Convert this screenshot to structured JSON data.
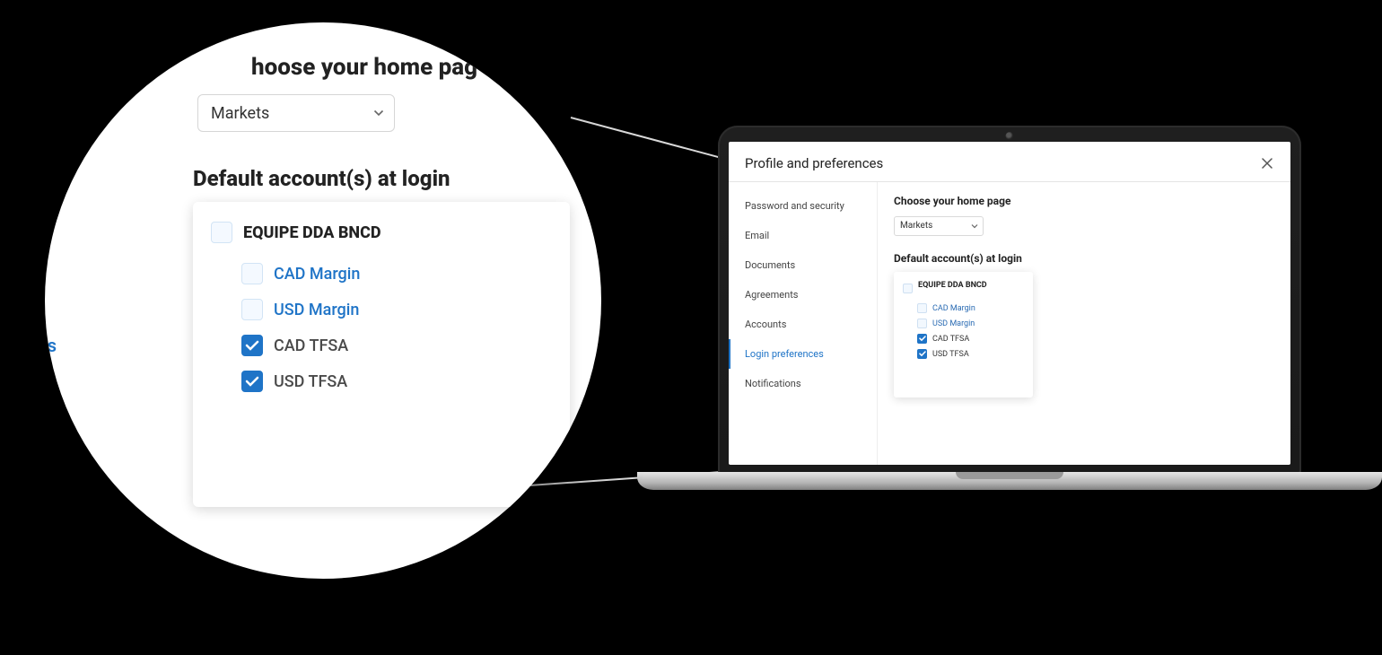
{
  "dialog": {
    "title": "Profile and preferences"
  },
  "sidebar": {
    "items": [
      {
        "label": "Password and security",
        "active": false
      },
      {
        "label": "Email",
        "active": false
      },
      {
        "label": "Documents",
        "active": false
      },
      {
        "label": "Agreements",
        "active": false
      },
      {
        "label": "Accounts",
        "active": false
      },
      {
        "label": "Login preferences",
        "active": true
      },
      {
        "label": "Notifications",
        "active": false
      }
    ]
  },
  "main": {
    "home_page_label": "Choose your home page",
    "home_page_value": "Markets",
    "default_accounts_label": "Default account(s) at login",
    "group_title": "EQUIPE DDA BNCD",
    "accounts": [
      {
        "label": "CAD Margin",
        "checked": false
      },
      {
        "label": "USD Margin",
        "checked": false
      },
      {
        "label": "CAD TFSA",
        "checked": true
      },
      {
        "label": "USD TFSA",
        "checked": true
      }
    ]
  },
  "zoom": {
    "title_fragment": "hoose your home pag",
    "select_value": "Markets",
    "section_label": "Default account(s) at login",
    "group_title": "EQUIPE DDA BNCD",
    "accounts": [
      {
        "label": "CAD Margin",
        "checked": false
      },
      {
        "label": "USD Margin",
        "checked": false
      },
      {
        "label": "CAD TFSA",
        "checked": true
      },
      {
        "label": "USD TFSA",
        "checked": true
      }
    ],
    "side_fragment": "es"
  }
}
